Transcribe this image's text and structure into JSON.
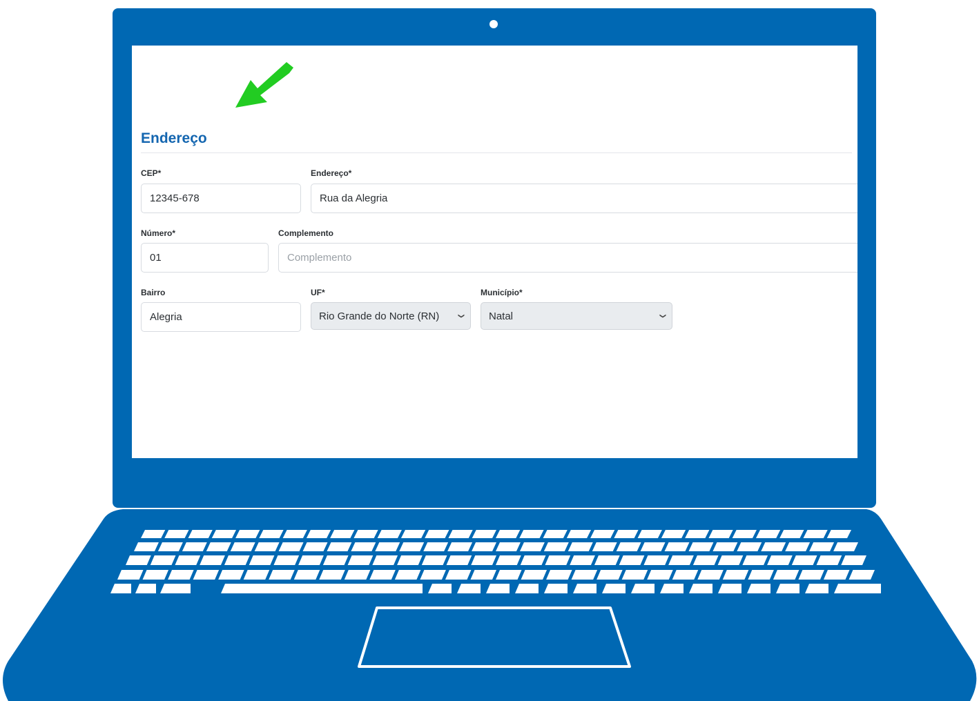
{
  "form": {
    "section_title": "Endereço",
    "cep": {
      "label": "CEP*",
      "value": "12345-678"
    },
    "endereco": {
      "label": "Endereço*",
      "value": "Rua da Alegria"
    },
    "numero": {
      "label": "Número*",
      "value": "01"
    },
    "complemento": {
      "label": "Complemento",
      "value": "",
      "placeholder": "Complemento"
    },
    "bairro": {
      "label": "Bairro",
      "value": "Alegria"
    },
    "uf": {
      "label": "UF*",
      "selected": "Rio Grande do Norte (RN)"
    },
    "municipio": {
      "label": "Município*",
      "selected": "Natal"
    }
  },
  "colors": {
    "laptop_body": "#0068b3",
    "title_blue": "#1466b0",
    "arrow_green": "#22cc22",
    "select_background": "#e9ecef"
  },
  "icons": {
    "pointer": "arrow-down-left-icon",
    "select_caret": "chevron-down-icon"
  }
}
